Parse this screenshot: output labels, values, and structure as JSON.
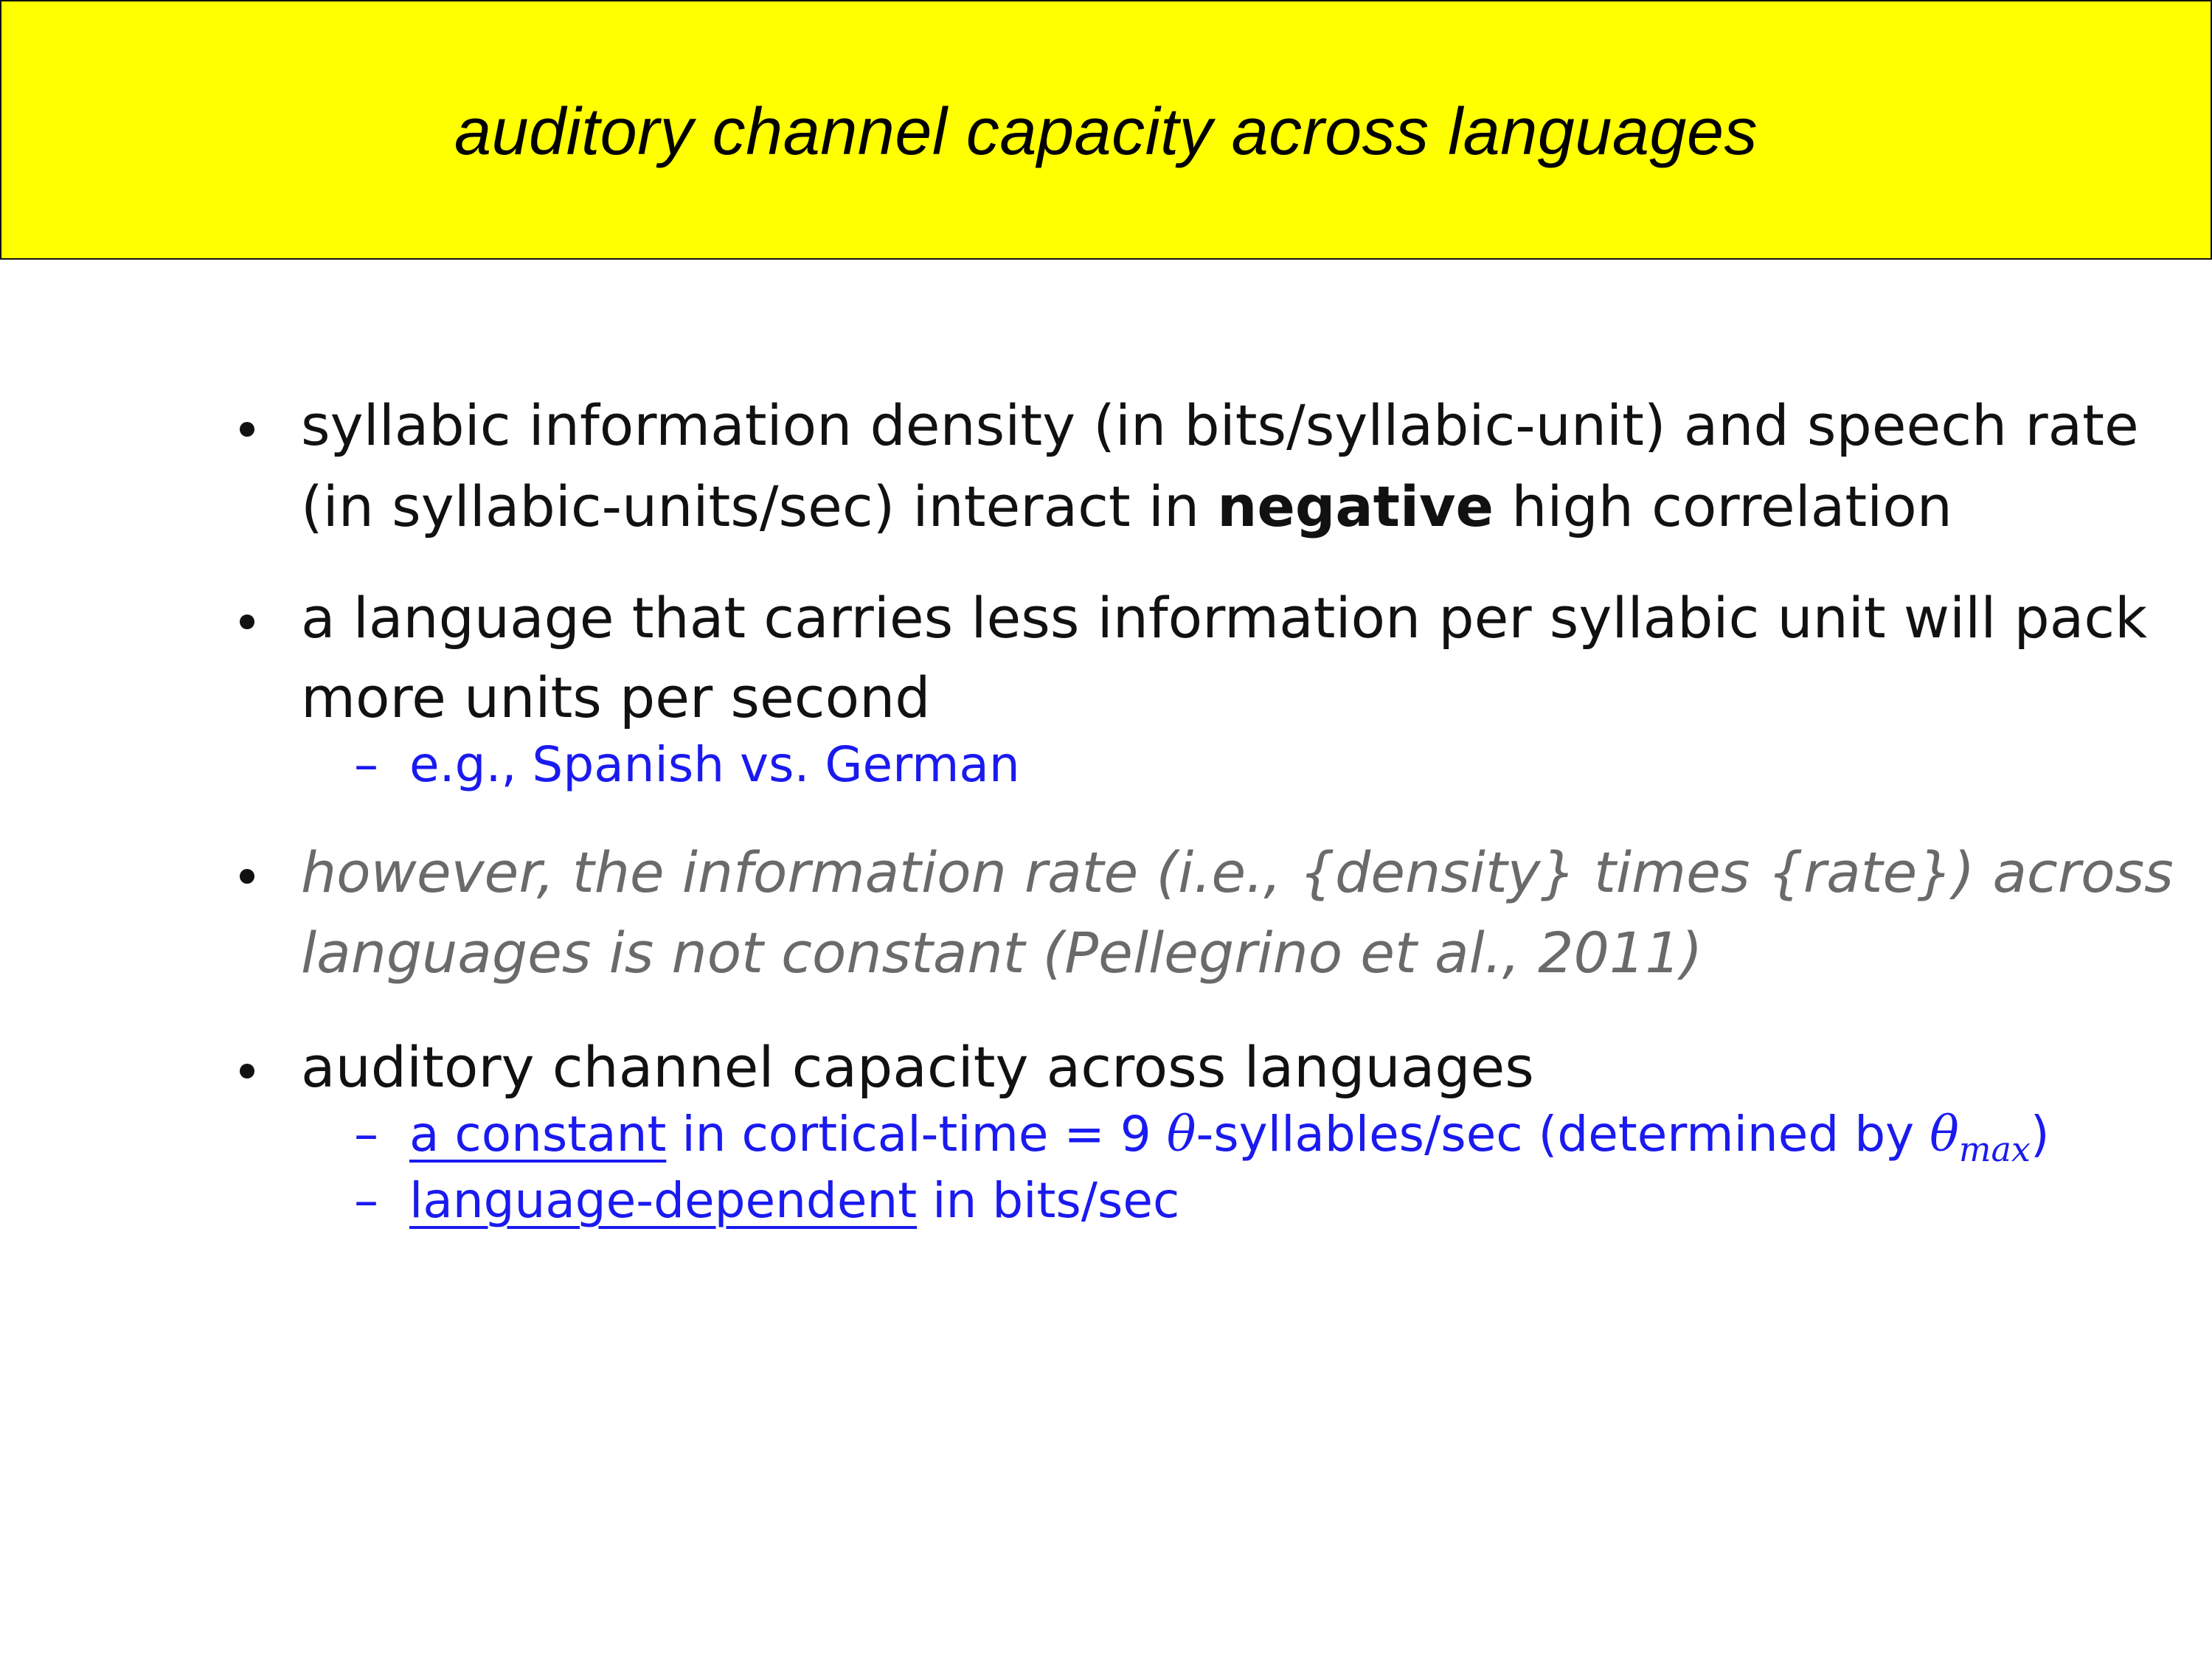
{
  "title": "auditory channel capacity across languages",
  "bullets": [
    {
      "lines": [
        "syllabic information density (in bits/syllabic-unit) and speech rate",
        ""
      ],
      "line2_pre": "(in syllabic-units/sec) interact in ",
      "line2_bold": "negative",
      "line2_post": " high correlation"
    },
    {
      "line1": "a language that carries less information per syllabic unit will pack",
      "line2": "more units per second",
      "sub1": "e.g., Spanish vs. German"
    },
    {
      "line1": "however, the information rate (i.e., {density} times {rate}) across",
      "line2": "languages is not constant (Pellegrino et al., 2011)"
    },
    {
      "line1": "auditory channel capacity across languages",
      "sub1_underlined": "a constant",
      "sub1_rest": " in cortical-time = 9 ",
      "sub1_theta": "θ",
      "sub1_rest2": "-syllables/sec (determined by ",
      "sub1_theta2": "θ",
      "sub1_subscript": "max",
      "sub1_close": ")",
      "sub2_underlined": "language-dependent",
      "sub2_rest": " in bits/sec"
    }
  ],
  "dash_symbol": "–",
  "colors": {
    "title_bg": "#ffff00",
    "sub_text": "#1a1af0",
    "muted_text": "#6a6a6a"
  }
}
